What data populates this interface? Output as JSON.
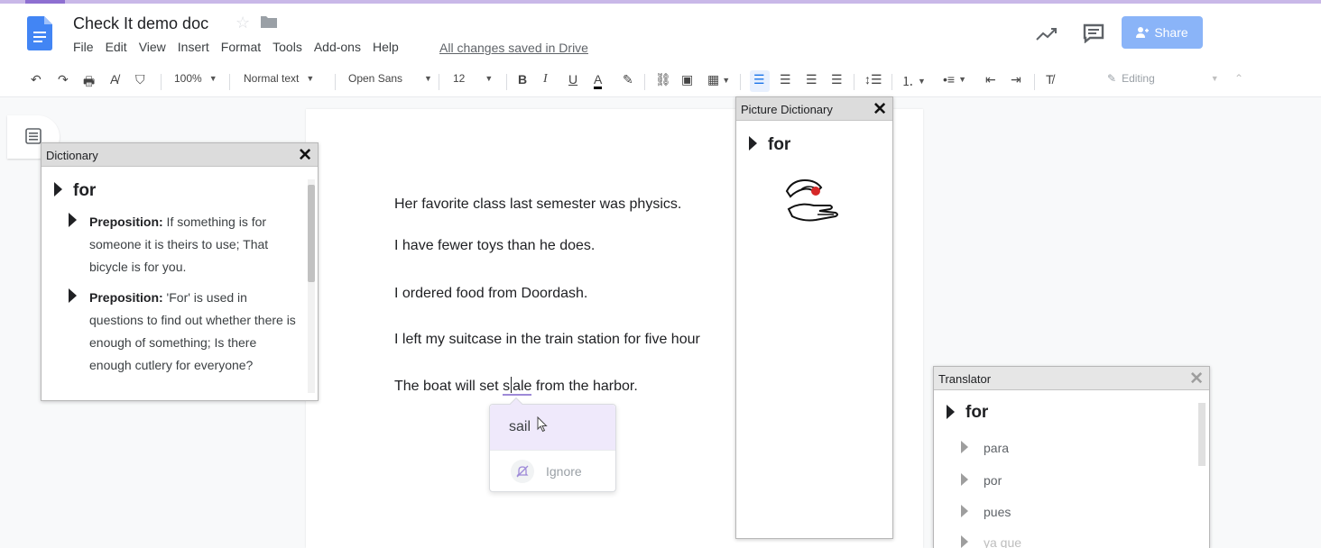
{
  "header": {
    "doc_title": "Check It demo doc",
    "menu": [
      "File",
      "Edit",
      "View",
      "Insert",
      "Format",
      "Tools",
      "Add-ons",
      "Help"
    ],
    "save_status": "All changes saved in Drive",
    "share_label": "Share"
  },
  "toolbar": {
    "zoom": "100%",
    "style": "Normal text",
    "font": "Open Sans",
    "size": "12",
    "mode": "Editing"
  },
  "document": {
    "lines": [
      "Her favorite class last semester was physics.",
      "I have fewer toys than he does.",
      "I ordered food from Doordash.",
      "I left my suitcase in the train station for five hour"
    ],
    "last_line_before": "The boat will set ",
    "misspelled_a": "s",
    "misspelled_b": "ale",
    "last_line_after": " from the harbor."
  },
  "suggestion": {
    "word": "sail",
    "ignore_label": "Ignore"
  },
  "dictionary": {
    "title": "Dictionary",
    "close": "✕",
    "headword": "for",
    "definitions": [
      {
        "pos": "Preposition:",
        "text": " If something is for someone it is theirs to use; That bicycle is for you."
      },
      {
        "pos": "Preposition:",
        "text": " 'For' is used in questions to find out whether there is enough of something; Is there enough cutlery for everyone?"
      }
    ]
  },
  "picture_dictionary": {
    "title": "Picture Dictionary",
    "close": "✕",
    "headword": "for"
  },
  "translator": {
    "title": "Translator",
    "close": "✕",
    "headword": "for",
    "translations": [
      "para",
      "por",
      "pues",
      "ya que"
    ]
  },
  "colors": {
    "accent": "#8ab4f8",
    "misspell_underline": "#9e8ad8",
    "suggestion_bg": "#efe9fb"
  }
}
